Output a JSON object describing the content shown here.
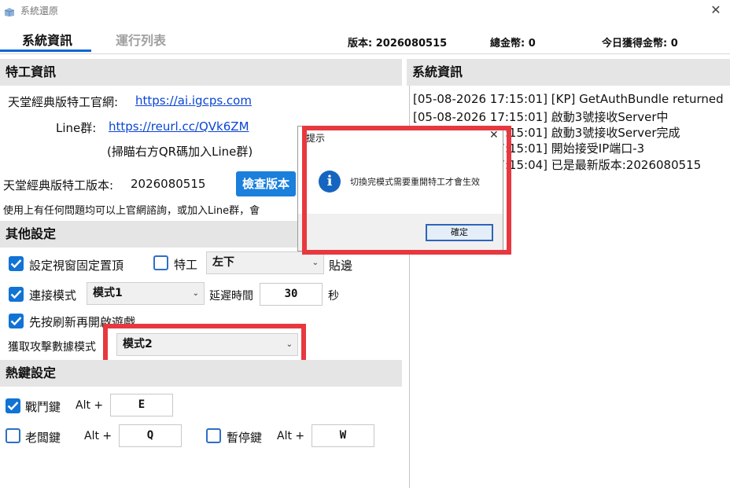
{
  "window": {
    "title": "系統還原"
  },
  "tabs": [
    {
      "label": "系統資訊"
    },
    {
      "label": "運行列表"
    }
  ],
  "stats": {
    "version": "版本: 2026080515",
    "total_coins": "總金幣:  0",
    "today_coins": "今日獲得金幣:  0"
  },
  "agent_info": {
    "header": "特工資訊",
    "website_label": "天堂經典版特工官網:",
    "website_url": "https://ai.igcps.com",
    "line_label": "Line群:",
    "line_url": "https://reurl.cc/QVk6ZM",
    "line_hint": "(掃瞄右方QR碼加入Line群)",
    "version_label": "天堂經典版特工版本:",
    "version_value": "2026080515",
    "check_button": "檢查版本",
    "help_text": "使用上有任何問題均可以上官網諮詢，或加入Line群，會"
  },
  "system_info": {
    "header": "系統資訊",
    "log": [
      "[05-08-2026 17:15:01] [KP] GetAuthBundle returned",
      "[05-08-2026 17:15:01] 啟動3號接收Server中",
      "[05-08-2026 17:15:01] 啟動3號接收Server完成",
      "[05-08-2026 17:15:01] 開始接受IP端口-3",
      "[05-08-2026 17:15:04] 已是最新版本:2026080515"
    ]
  },
  "other_settings": {
    "header": "其他設定",
    "pin_window": {
      "label": "設定視窗固定置頂",
      "checked": true
    },
    "agent": {
      "label": "特工",
      "checked": false
    },
    "position_select": "左下",
    "snap_label": "貼邊",
    "connect_mode": {
      "label": "連接模式",
      "checked": true
    },
    "connect_select": "模式1",
    "delay_label": "延遲時間",
    "delay_value": "30",
    "delay_unit": "秒",
    "refresh_first": {
      "label": "先按刷新再開啟遊戲",
      "checked": true
    },
    "attack_mode_label": "獲取攻擊數據模式",
    "attack_mode_select": "模式2"
  },
  "hotkeys": {
    "header": "熱鍵設定",
    "battle": {
      "label": "戰鬥鍵",
      "checked": true,
      "mod": "Alt +",
      "key": "E"
    },
    "boss": {
      "label": "老闆鍵",
      "checked": false,
      "mod": "Alt +",
      "key": "Q"
    },
    "pause": {
      "label": "暫停鍵",
      "checked": false,
      "mod": "Alt +",
      "key": "W"
    }
  },
  "dialog": {
    "title": "提示",
    "message": "切換完模式需要重開特工才會生效",
    "ok_button": "確定"
  },
  "colors": {
    "accent": "#1b7fdc",
    "highlight_border": "#e8383f",
    "section_bg": "#e5e5e5"
  },
  "icons": {
    "info": "i"
  }
}
